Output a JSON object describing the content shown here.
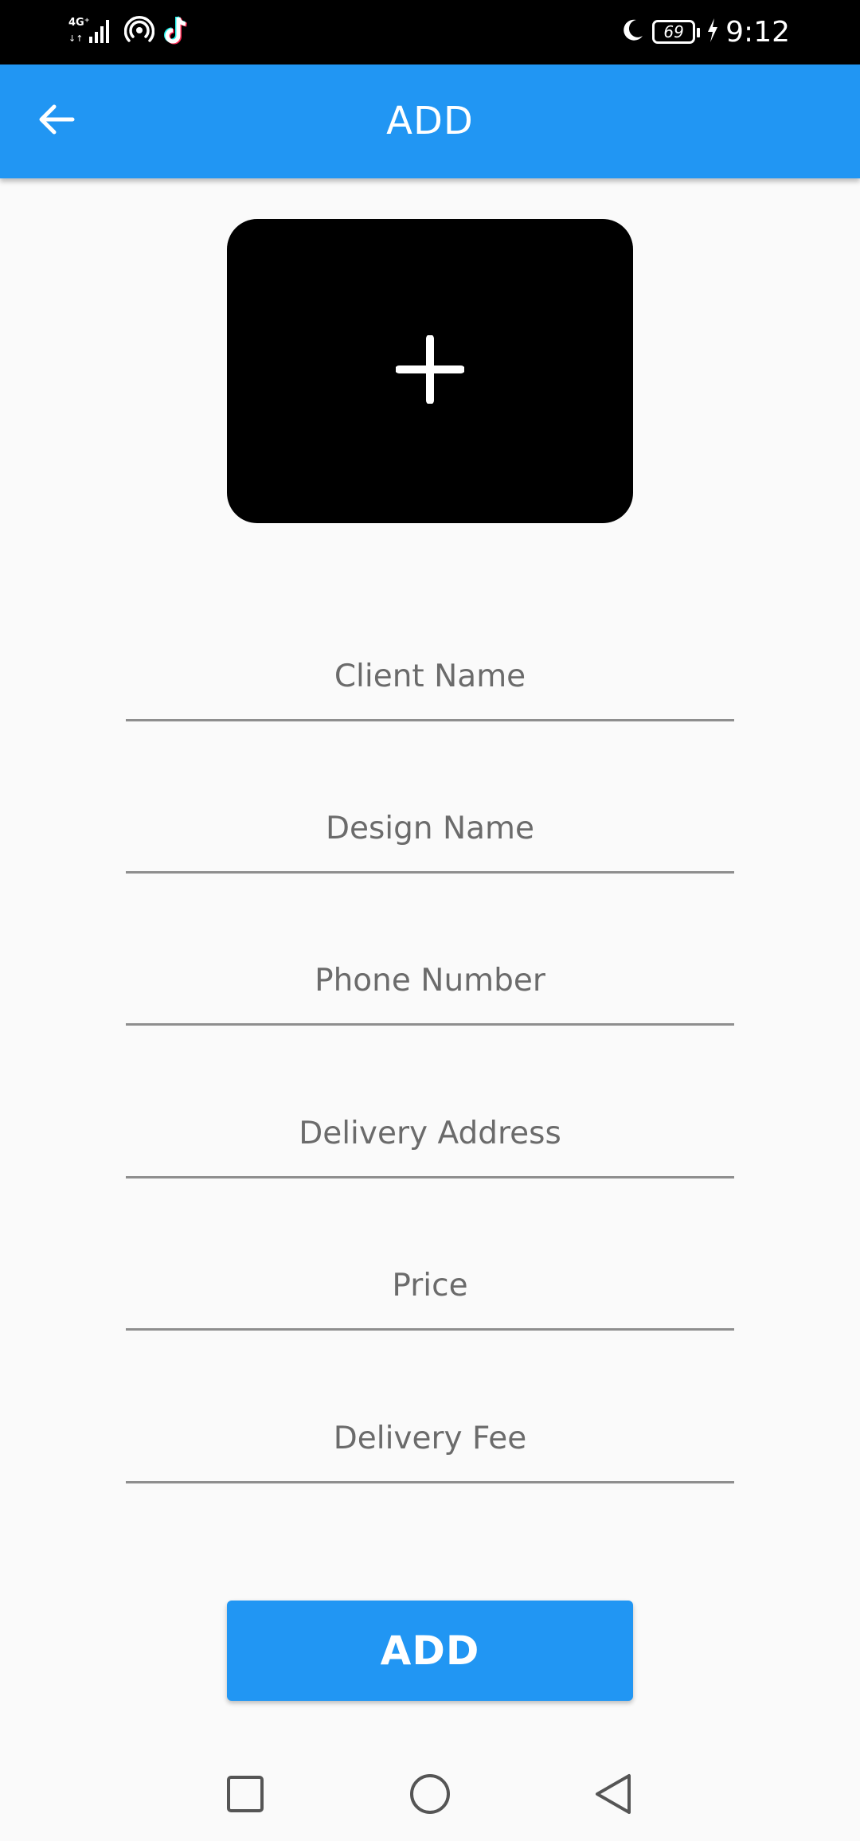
{
  "status_bar": {
    "network_label": "4G",
    "battery_level": "69",
    "time": "9:12",
    "icons": [
      "signal-icon",
      "hotspot-icon",
      "tiktok-icon",
      "moon-icon",
      "battery-icon",
      "charging-icon"
    ]
  },
  "app_bar": {
    "title": "ADD",
    "back_icon": "arrow-left-icon",
    "background_color": "#2196f3"
  },
  "image_picker": {
    "icon": "plus-icon"
  },
  "form": {
    "client_name": {
      "placeholder": "Client Name",
      "value": ""
    },
    "design_name": {
      "placeholder": "Design Name",
      "value": ""
    },
    "phone_number": {
      "placeholder": "Phone Number",
      "value": ""
    },
    "delivery_address": {
      "placeholder": "Delivery Address",
      "value": ""
    },
    "price": {
      "placeholder": "Price",
      "value": ""
    },
    "delivery_fee": {
      "placeholder": "Delivery Fee",
      "value": ""
    }
  },
  "submit_button": {
    "label": "ADD",
    "color": "#2196f3"
  },
  "nav_bar": {
    "icons": [
      "recents-square-icon",
      "home-circle-icon",
      "back-triangle-icon"
    ]
  }
}
